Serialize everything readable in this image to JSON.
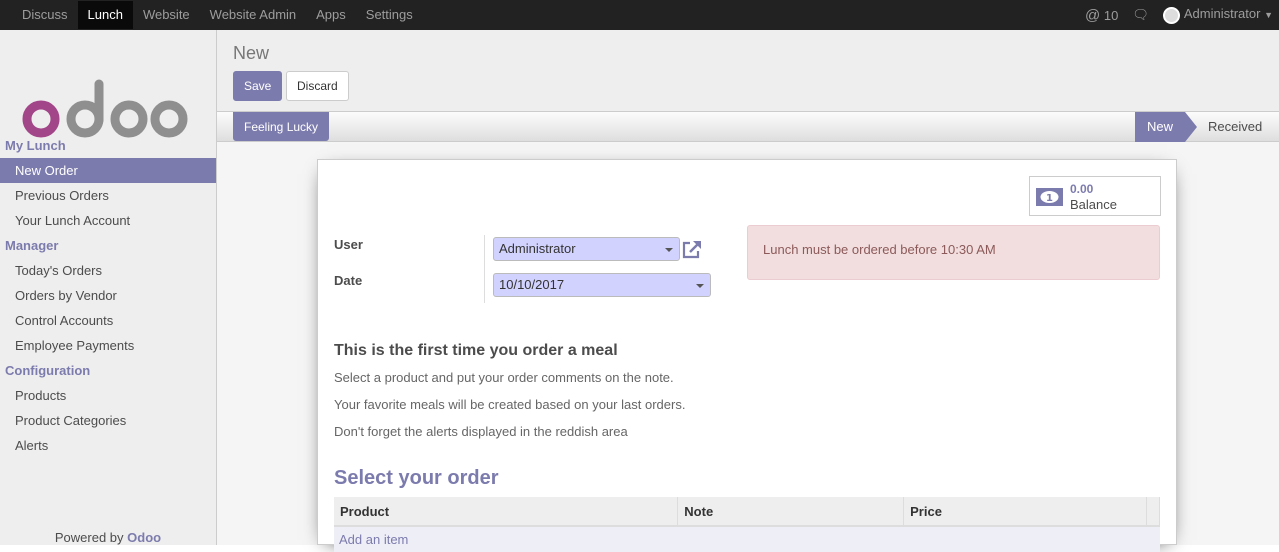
{
  "topbar": {
    "menu": [
      "Discuss",
      "Lunch",
      "Website",
      "Website Admin",
      "Apps",
      "Settings"
    ],
    "active": "Lunch",
    "mentions": "10",
    "user": "Administrator"
  },
  "sidebar": {
    "sections": [
      {
        "title": "My Lunch",
        "items": [
          "New Order",
          "Previous Orders",
          "Your Lunch Account"
        ]
      },
      {
        "title": "Manager",
        "items": [
          "Today's Orders",
          "Orders by Vendor",
          "Control Accounts",
          "Employee Payments"
        ]
      },
      {
        "title": "Configuration",
        "items": [
          "Products",
          "Product Categories",
          "Alerts"
        ]
      }
    ],
    "active": "New Order",
    "powered_prefix": "Powered by",
    "powered_brand": "Odoo"
  },
  "control": {
    "title": "New",
    "save": "Save",
    "discard": "Discard"
  },
  "statusbar": {
    "action": "Feeling Lucky",
    "stages": [
      "New",
      "Received"
    ],
    "current": "New"
  },
  "form": {
    "balance_value": "0.00",
    "balance_label": "Balance",
    "user_label": "User",
    "user_value": "Administrator",
    "date_label": "Date",
    "date_value": "10/10/2017",
    "alert": "Lunch must be ordered before 10:30 AM",
    "intro_title": "This is the first time you order a meal",
    "intro_lines": [
      "Select a product and put your order comments on the note.",
      "Your favorite meals will be created based on your last orders.",
      "Don't forget the alerts displayed in the reddish area"
    ],
    "order_title": "Select your order",
    "columns": [
      "Product",
      "Note",
      "Price"
    ],
    "add_item": "Add an item"
  },
  "colors": {
    "accent": "#7c7bad",
    "topbar": "#222222",
    "alert_bg": "#f2dede",
    "field_bg": "#d2d2ff"
  }
}
